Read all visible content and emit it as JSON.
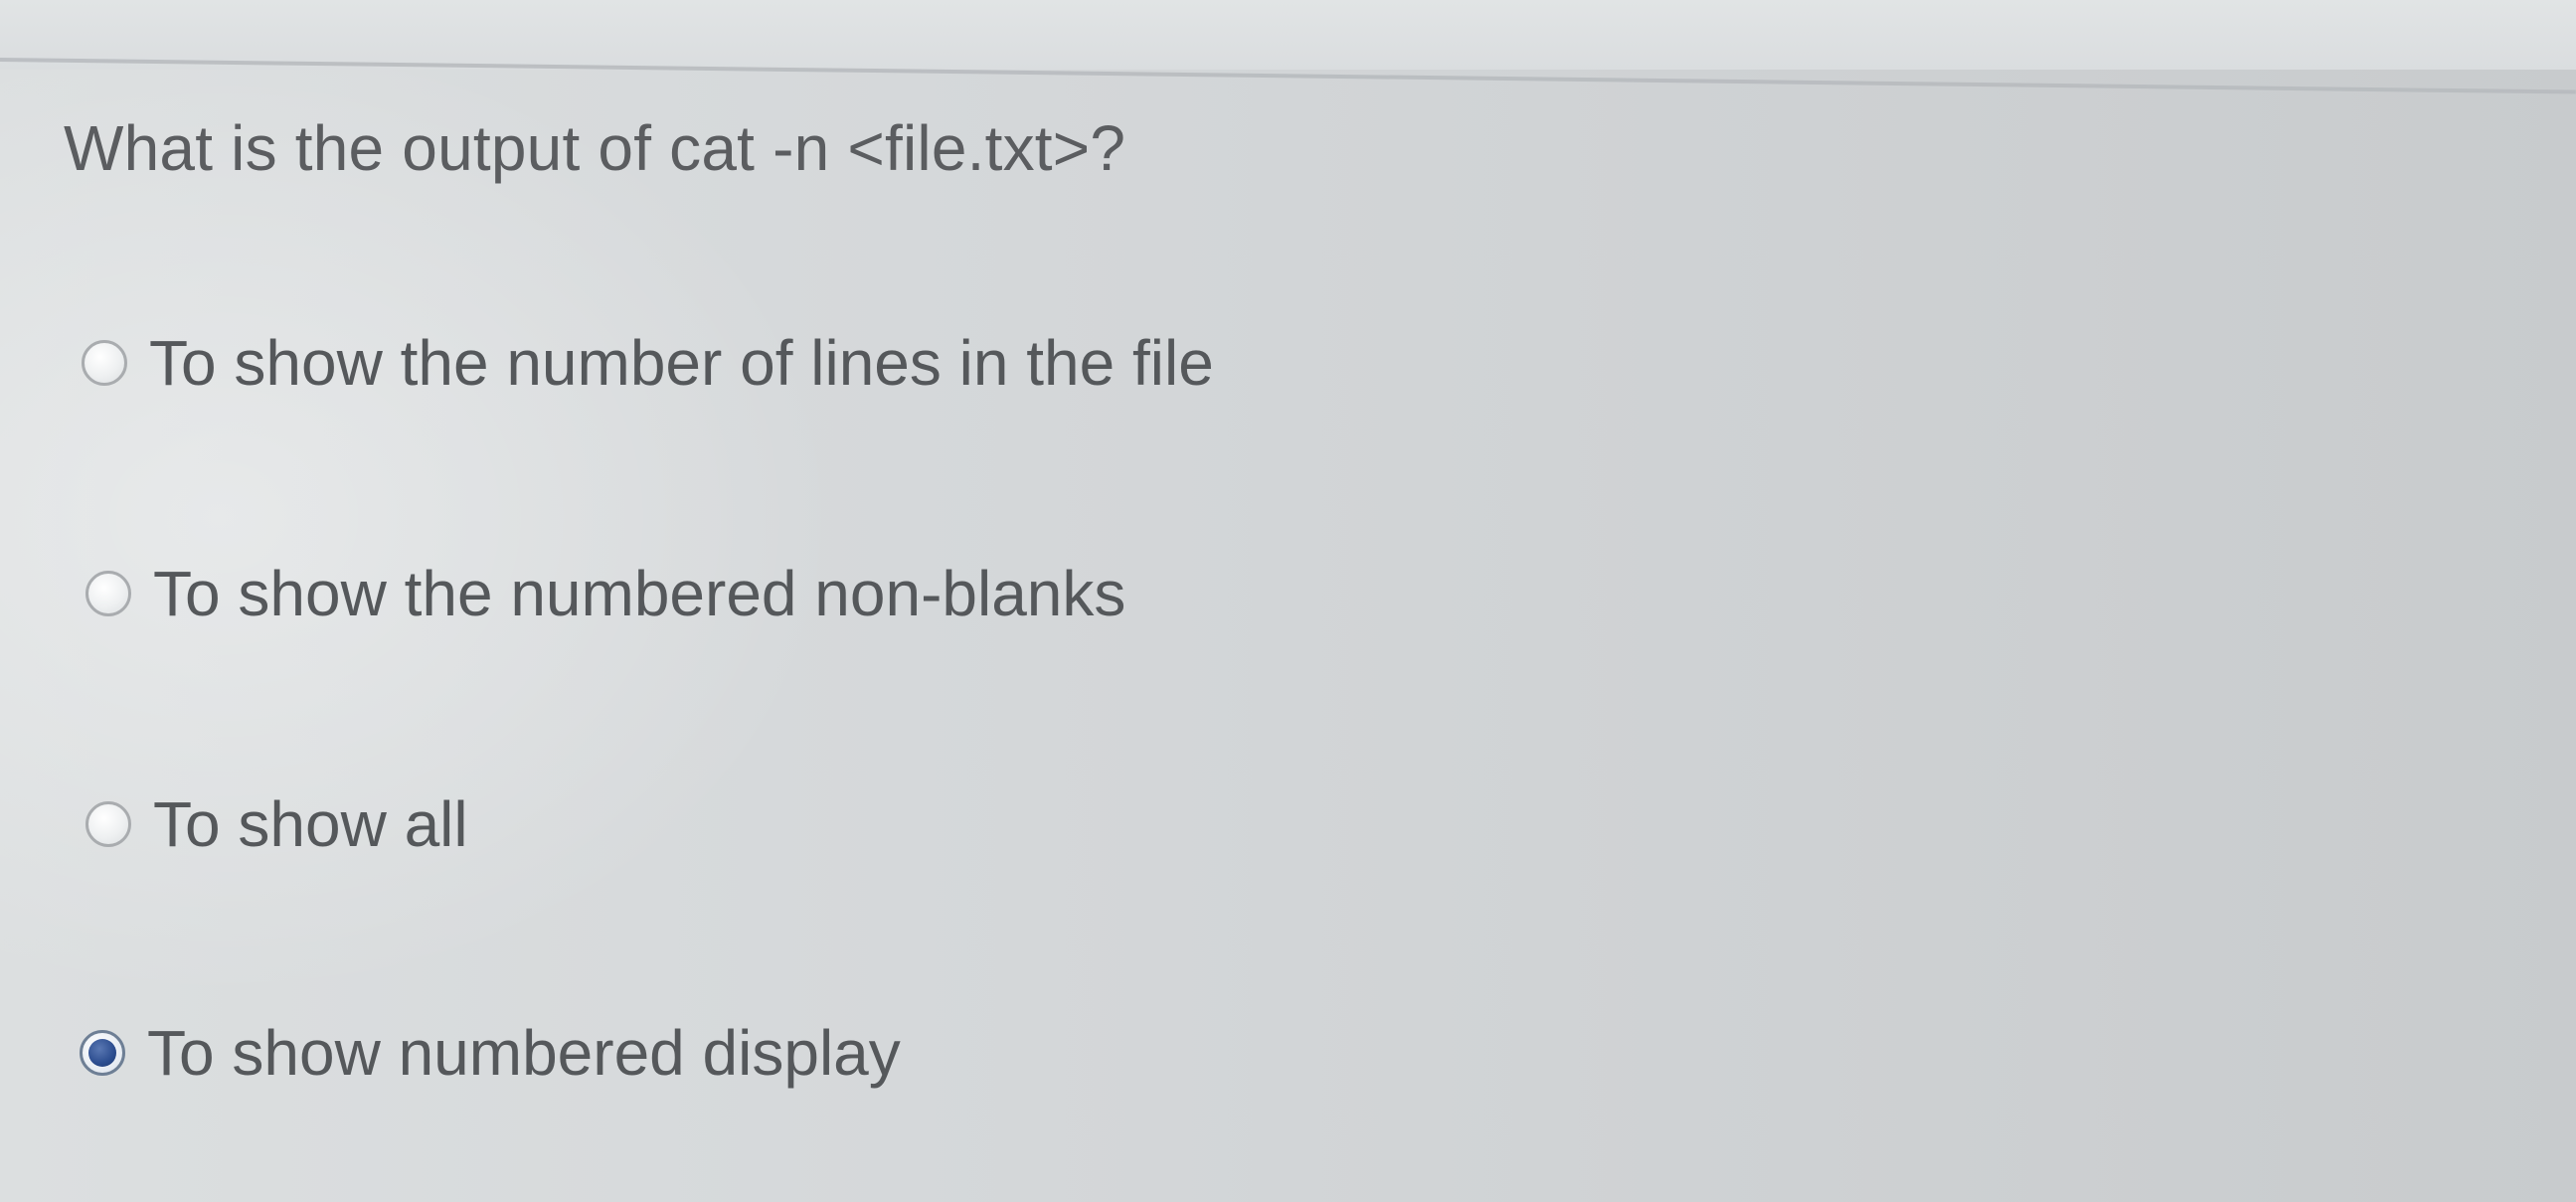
{
  "question": {
    "text": "What is the output of cat -n <file.txt>?"
  },
  "options": [
    {
      "label": "To show the number of lines in the file",
      "selected": false
    },
    {
      "label": "To show the numbered non-blanks",
      "selected": false
    },
    {
      "label": "To show all",
      "selected": false
    },
    {
      "label": "To show numbered display",
      "selected": true
    }
  ],
  "colors": {
    "background": "#d5d8da",
    "text": "#55585b",
    "radio_selected": "#2c4d8f"
  }
}
